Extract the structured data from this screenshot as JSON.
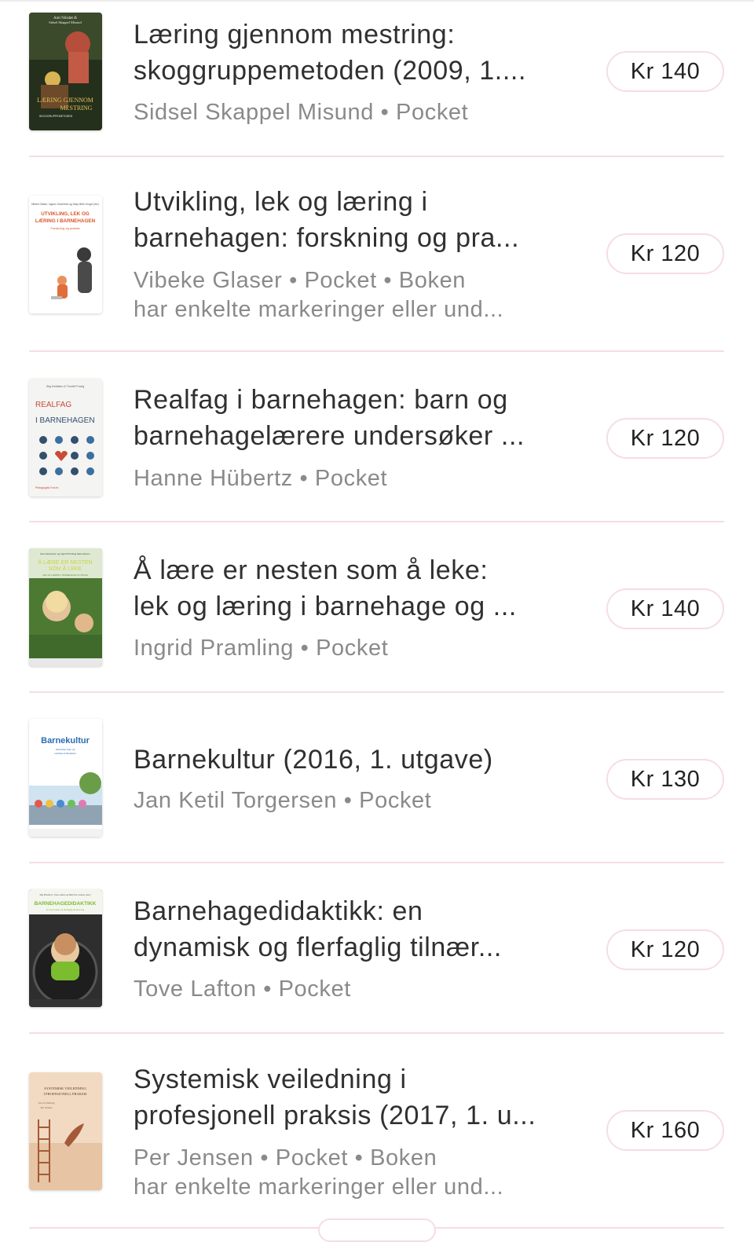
{
  "listings": [
    {
      "title_line1": "Læring gjennom mestring:",
      "title_line2": "skoggruppemetoden (2009, 1....",
      "meta_line1": "Sidsel Skappel Misund • Pocket",
      "meta_line2": "",
      "price": "Kr 140",
      "cover": {
        "texts": [
          "Anit Nilsdøt &",
          "Sidsel Skappel Misund",
          "LÆRING GJENNOM",
          "MESTRING",
          "SKOGGRUPPEMETODEN"
        ],
        "colors": [
          "#1e2a16",
          "#b54e3b",
          "#d8b454"
        ]
      }
    },
    {
      "title_line1": "Utvikling, lek og læring i",
      "title_line2": "barnehagen: forskning og pra...",
      "meta_line1": "Vibeke Glaser • Pocket • Boken",
      "meta_line2": "har enkelte markeringer eller und...",
      "price": "Kr 120",
      "cover": {
        "texts": [
          "Vibeke Glaser, Ingunn Granheim og Mary Beth Krogh (red.)",
          "UTVIKLING, LEK OG",
          "LÆRING I BARNEHAGEN",
          "Forskning og praksis"
        ],
        "colors": [
          "#ffffff",
          "#d9562a",
          "#e8925a"
        ]
      }
    },
    {
      "title_line1": "Realfag i barnehagen: barn og",
      "title_line2": "barnehagelærere undersøker ...",
      "meta_line1": "Hanne Hübertz • Pocket",
      "meta_line2": "",
      "price": "Kr 120",
      "cover": {
        "texts": [
          "Stig Hvidtsten & Thorleif Frøvig",
          "REALFAG",
          "I BARNEHAGEN",
          "Pedagogisk Forum"
        ],
        "colors": [
          "#f4f4f2",
          "#c94a36",
          "#33506f"
        ]
      }
    },
    {
      "title_line1": "Å lære er nesten som å leke:",
      "title_line2": "lek og læring i barnehage og ...",
      "meta_line1": "Ingrid Pramling • Pocket",
      "meta_line2": "",
      "price": "Kr 140",
      "cover": {
        "texts": [
          "Eva Johansson og Ingrid Pramling Samuelsson",
          "Å LÆRE ER NESTEN",
          "SOM Å LEKE",
          "LEK OG LÆRING I BARNEHAGE OG SKOLE"
        ],
        "colors": [
          "#5b8a3c",
          "#e4c29a",
          "#c6d44a"
        ]
      }
    },
    {
      "title_line1": "Barnekultur (2016, 1. utgave)",
      "title_line2": "",
      "meta_line1": "Jan Ketil Torgersen • Pocket",
      "meta_line2": "",
      "price": "Kr 130",
      "cover": {
        "texts": [
          "Barnekultur",
          "Historiske linjer og",
          "nordiske forbindelser"
        ],
        "colors": [
          "#ffffff",
          "#2b6db3",
          "#6a9d48"
        ]
      }
    },
    {
      "title_line1": "Barnehagedidaktikk: en",
      "title_line2": "dynamisk og flerfaglig tilnær...",
      "meta_line1": "Tove Lafton • Pocket",
      "meta_line2": "",
      "price": "Kr 120",
      "cover": {
        "texts": [
          "Stig Broström, Tove Lafton og Mari Ann Letnes (red.)",
          "BARNEHAGEDIDAKTIKK",
          "En dynamisk og flerfaglig tilnærming"
        ],
        "colors": [
          "#2e2e2e",
          "#7bbd2f",
          "#e8c9a0"
        ]
      }
    },
    {
      "title_line1": "Systemisk veiledning i",
      "title_line2": "profesjonell praksis (2017, 1. u...",
      "meta_line1": "Per Jensen • Pocket • Boken",
      "meta_line2": "har enkelte markeringer eller und...",
      "price": "Kr 160",
      "cover": {
        "texts": [
          "SYSTEMISK VEILEDNING",
          "I PROFESJONELL PRAKSIS",
          "Jacob Ulleberg",
          "Per Jensen"
        ],
        "colors": [
          "#f1d9c2",
          "#a45a38",
          "#8a5a3a"
        ]
      }
    }
  ]
}
